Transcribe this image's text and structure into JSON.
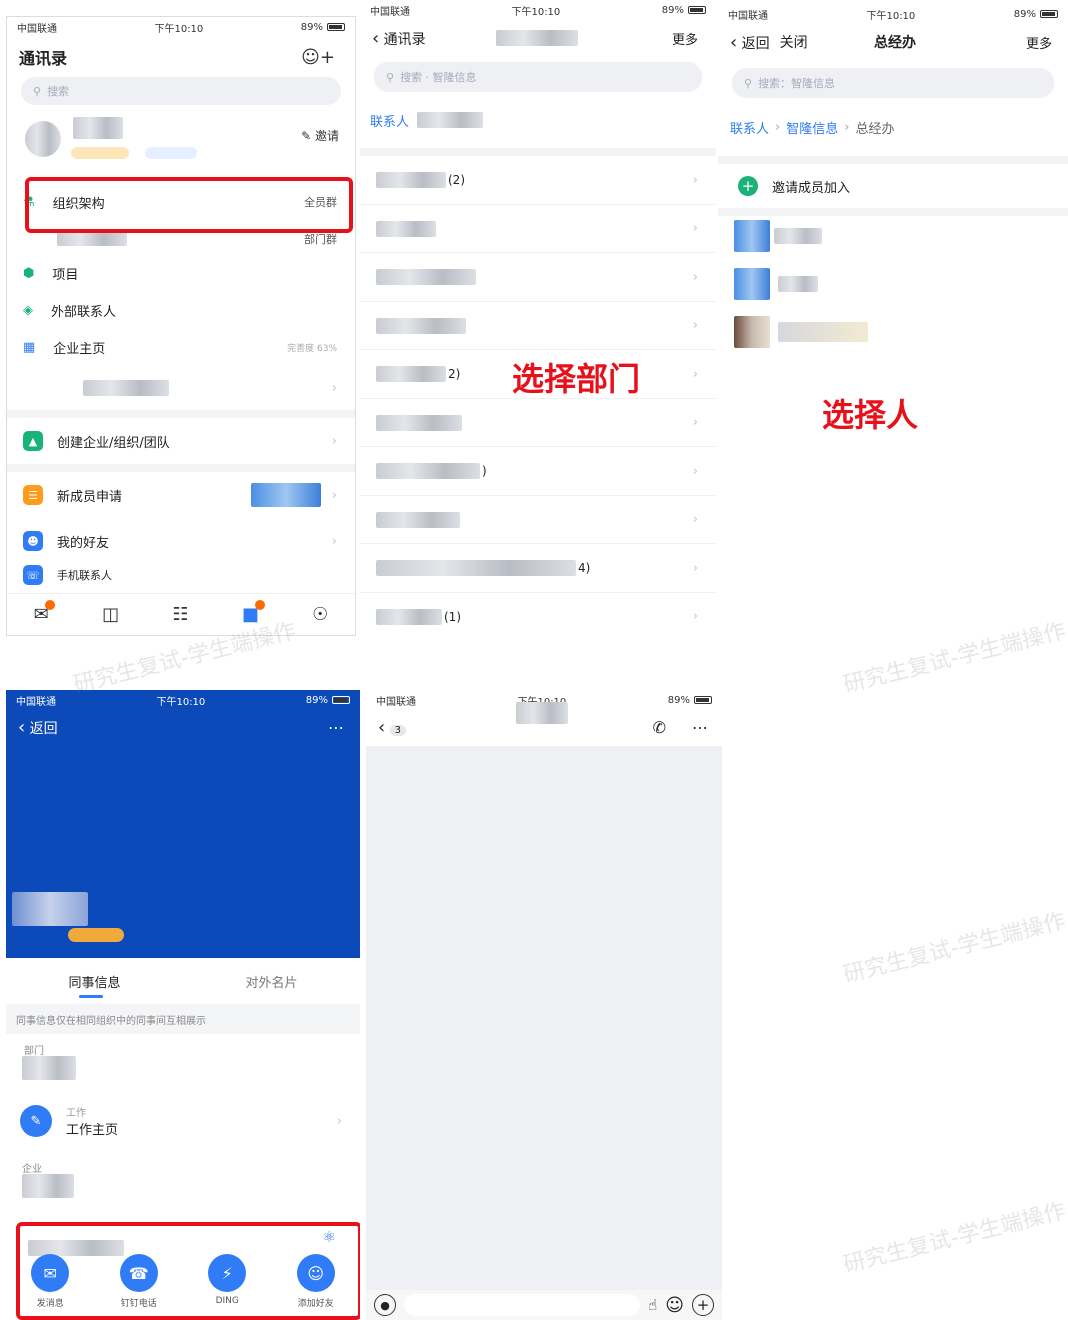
{
  "watermark": "研究生复试-学生端操作",
  "s1": {
    "status": {
      "carrier": "中国联通",
      "time": "下午10:10",
      "battery": "89%"
    },
    "title": "通讯录",
    "search_placeholder": "搜索",
    "invite_label": "邀请",
    "org_label": "组织架构",
    "org_right": "全员群",
    "dept_right": "部门群",
    "items": [
      {
        "label": "项目",
        "icon": "hexagon-icon",
        "color": "#19b37a"
      },
      {
        "label": "外部联系人",
        "icon": "contact-icon",
        "color": "#19b37a"
      },
      {
        "label": "企业主页",
        "icon": "building-icon",
        "color": "#2f7cf6",
        "right": "完善度 63%"
      }
    ],
    "create_label": "创建企业/组织/团队",
    "new_member_label": "新成员申请",
    "friends_label": "我的好友",
    "mobile_contacts_label": "手机联系人",
    "tabs": [
      "消息",
      "文档",
      "工作台",
      "通讯录",
      "我的"
    ]
  },
  "s2": {
    "status": {
      "carrier": "中国联通",
      "time": "下午10:10",
      "battery": "89%"
    },
    "back_label": "通讯录",
    "more_label": "更多",
    "search_placeholder": "搜索 · 智隆信息",
    "crumb": "联系人",
    "annotation": "选择部门",
    "rows": [
      "(2)",
      "",
      "",
      "",
      "2)",
      "",
      ")",
      "",
      "4)",
      "(1)"
    ]
  },
  "s3": {
    "status": {
      "carrier": "中国联通",
      "time": "下午10:10",
      "battery": "89%"
    },
    "back_label": "返回",
    "close_label": "关闭",
    "title": "总经办",
    "more_label": "更多",
    "search_placeholder": "搜索：智隆信息",
    "crumb": [
      "联系人",
      "智隆信息",
      "总经办"
    ],
    "invite_label": "邀请成员加入",
    "annotation": "选择人"
  },
  "s4": {
    "status": {
      "carrier": "中国联通",
      "time": "下午10:10",
      "battery": "89%"
    },
    "back_label": "返回",
    "tab_colleague": "同事信息",
    "tab_card": "对外名片",
    "notice": "同事信息仅在相同组织中的同事间互相展示",
    "work_sub": "工作",
    "work_label": "工作主页",
    "dept_label": "部门",
    "enterprise_label": "企业",
    "actions": [
      "发消息",
      "钉钉电话",
      "DING",
      "添加好友"
    ],
    "action_icons": [
      "chat-icon",
      "phone-icon",
      "bolt-icon",
      "add-friend-icon"
    ]
  },
  "s5": {
    "status": {
      "carrier": "中国联通",
      "time": "下午10:10",
      "battery": "89%"
    },
    "back_count": "3"
  }
}
